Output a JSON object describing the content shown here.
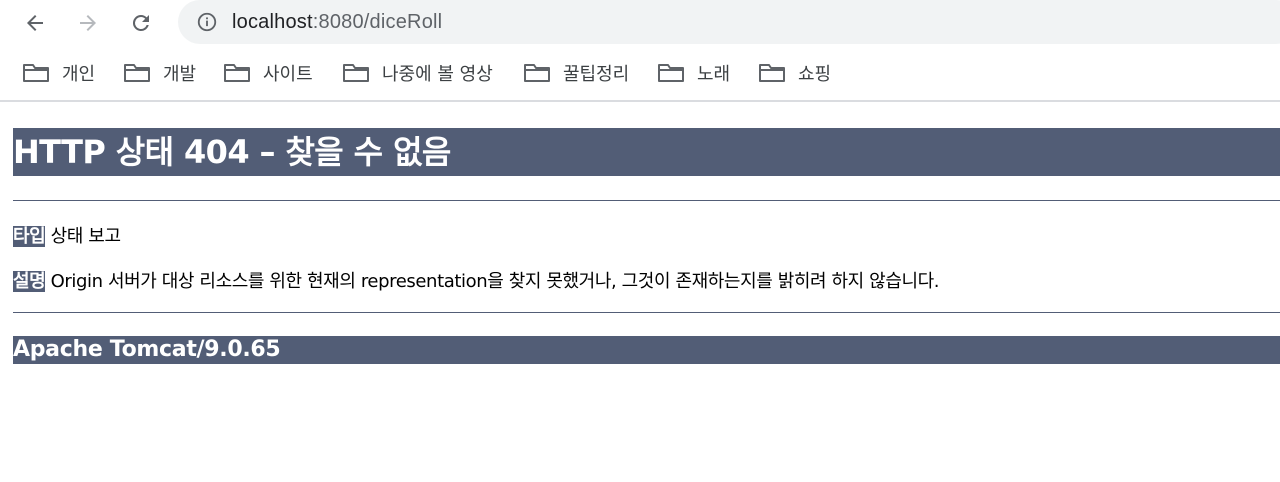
{
  "browser": {
    "url_host": "localhost",
    "url_rest": ":8080/diceRoll",
    "bookmarks": [
      {
        "label": "개인"
      },
      {
        "label": "개발"
      },
      {
        "label": "사이트"
      },
      {
        "label": "나중에 볼 영상"
      },
      {
        "label": "꿀팁정리"
      },
      {
        "label": "노래"
      },
      {
        "label": "쇼핑"
      }
    ]
  },
  "page": {
    "heading": "HTTP 상태 404 – 찾을 수 없음",
    "type_label": "타입",
    "type_value": " 상태 보고",
    "desc_label": "설명",
    "desc_value": " Origin 서버가 대상 리소스를 위한 현재의 representation을 찾지 못했거나, 그것이 존재하는지를 밝히려 하지 않습니다.",
    "footer": "Apache Tomcat/9.0.65"
  }
}
